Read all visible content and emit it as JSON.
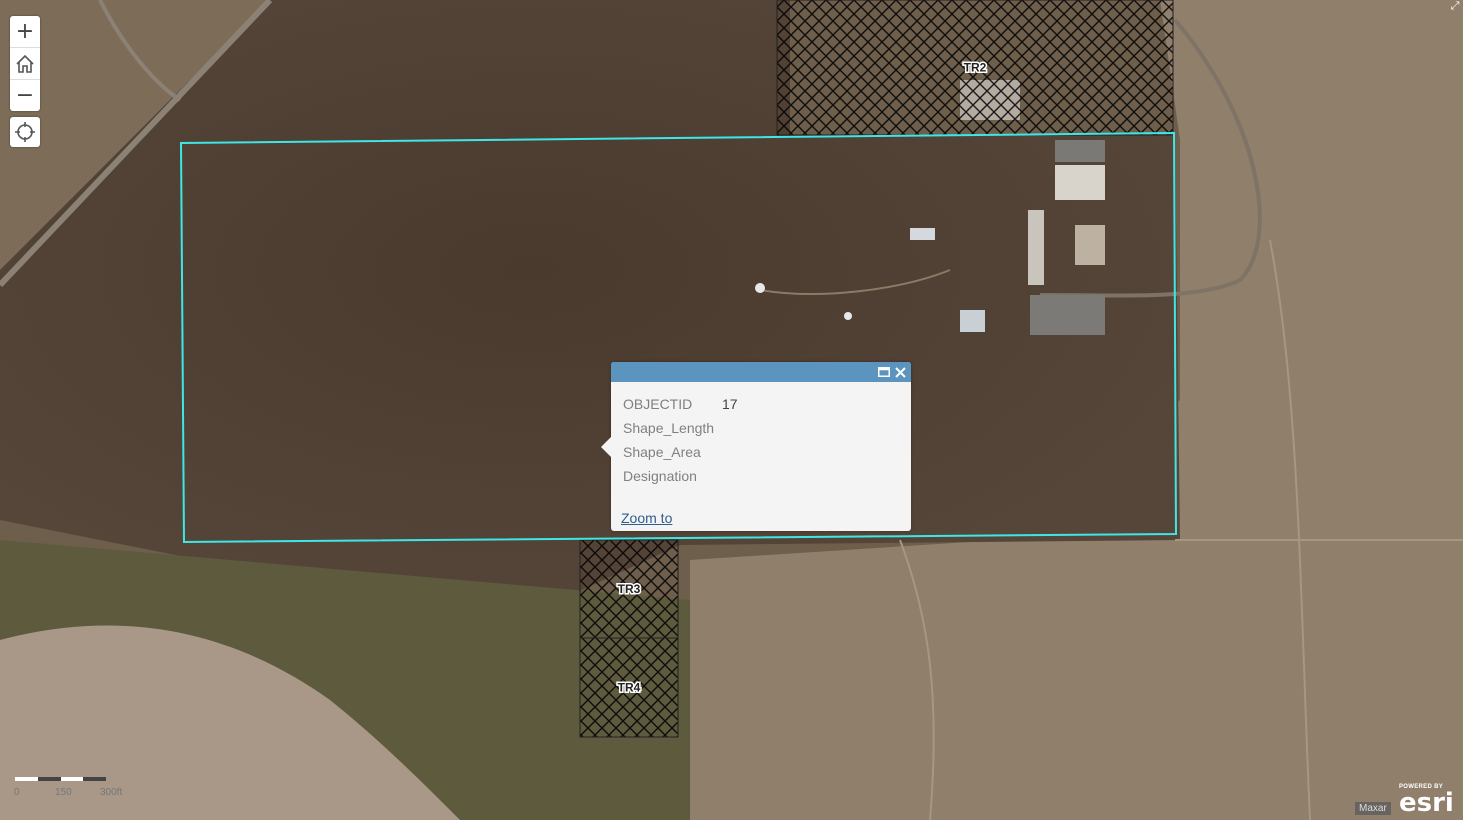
{
  "map": {
    "basemap": "satellite imagery",
    "parcels": [
      {
        "label": "TR2",
        "style": "crosshatch"
      },
      {
        "label": "TR3",
        "style": "crosshatch"
      },
      {
        "label": "TR4",
        "style": "crosshatch"
      }
    ],
    "selected_feature_outline_color": "#3ee6e6"
  },
  "controls": {
    "zoom_in_label": "+",
    "zoom_out_label": "−",
    "home_icon": "home-icon",
    "locate_icon": "locate-crosshair-icon",
    "expand_icon": "expand-icon"
  },
  "popup": {
    "header_color": "#5b95bf",
    "maximize_icon": "maximize-icon",
    "close_icon": "close-icon",
    "attributes": [
      {
        "name": "OBJECTID",
        "value": "17"
      },
      {
        "name": "Shape_Length",
        "value": ""
      },
      {
        "name": "Shape_Area",
        "value": ""
      },
      {
        "name": "Designation",
        "value": ""
      }
    ],
    "zoom_to_label": "Zoom to"
  },
  "scalebar": {
    "labels": [
      "0",
      "150",
      "300ft"
    ]
  },
  "attribution": {
    "text": "Maxar"
  },
  "logo": {
    "powered_by": "POWERED BY",
    "name": "esri"
  }
}
